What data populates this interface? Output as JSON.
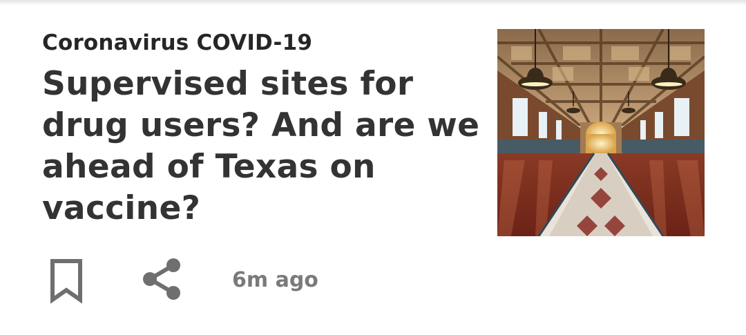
{
  "article": {
    "category": "Coronavirus COVID-19",
    "headline": "Supervised sites for drug users? And are we ahead of Texas on vaccine?",
    "timestamp": "6m ago",
    "thumbnail_icon": "station-hall-photo"
  },
  "actions": {
    "bookmark_icon": "bookmark-icon",
    "share_icon": "share-icon"
  },
  "colors": {
    "text_primary": "#333333",
    "text_secondary": "#7a7a7a",
    "icon": "#6f6f6f",
    "background": "#ffffff"
  }
}
